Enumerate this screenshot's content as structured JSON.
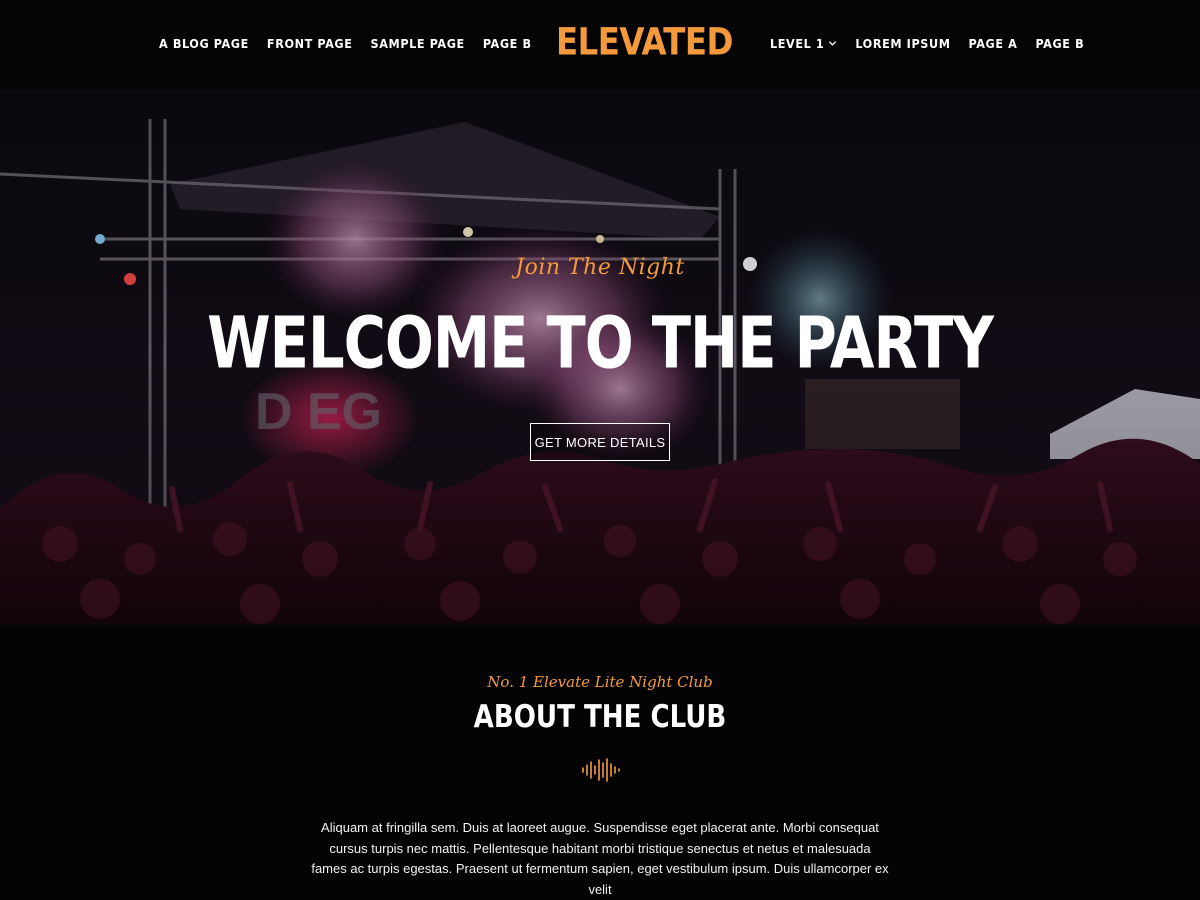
{
  "brand": {
    "logo": "ELEVATED",
    "accent": "#f59a3c"
  },
  "nav": {
    "left": [
      "A BLOG PAGE",
      "FRONT PAGE",
      "SAMPLE PAGE",
      "PAGE B"
    ],
    "right": [
      "LEVEL 1",
      "LOREM IPSUM",
      "PAGE A",
      "PAGE B"
    ]
  },
  "hero": {
    "tagline": "Join The Night",
    "title": "WELCOME TO THE PARTY",
    "button": "GET MORE DETAILS"
  },
  "about": {
    "tagline": "No. 1 Elevate Lite Night Club",
    "title": "ABOUT THE CLUB",
    "text": "Aliquam at fringilla sem. Duis at laoreet augue. Suspendisse eget placerat ante. Morbi consequat cursus turpis nec mattis. Pellentesque habitant morbi tristique senectus et netus et malesuada fames ac turpis egestas. Praesent ut fermentum sapien, eget vestibulum ipsum. Duis ullamcorper ex velit"
  }
}
